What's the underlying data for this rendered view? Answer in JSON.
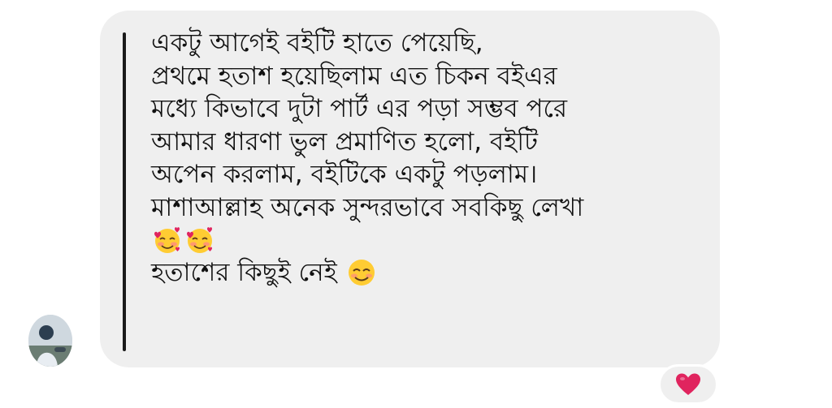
{
  "message": {
    "lines": [
      "একটু আগেই বইটি হাতে পেয়েছি,",
      "প্রথমে হতাশ হয়েছিলাম এত চিকন বইএর",
      "মধ্যে কিভাবে দুটা পার্ট এর পড়া সম্ভব পরে",
      "আমার ধারণা ভুল প্রমাণিত হলো, বইটি",
      "অপেন করলাম, বইটিকে একটু পড়লাম।",
      "মাশাআল্লাহ অনেক সুন্দরভাবে সবকিছু লেখা"
    ],
    "emoji_line": [
      "smiling-face-with-hearts-icon",
      "smiling-face-with-hearts-icon"
    ],
    "last_line": "হতাশের কিছুই নেই",
    "last_line_emoji": "smiling-face-with-smiling-eyes-icon"
  },
  "reaction": {
    "icon": "red-heart-icon"
  },
  "colors": {
    "bubble": "#efefef",
    "text": "#111111",
    "quote_bar": "#1a1a1a",
    "heart": "#e0245e"
  }
}
